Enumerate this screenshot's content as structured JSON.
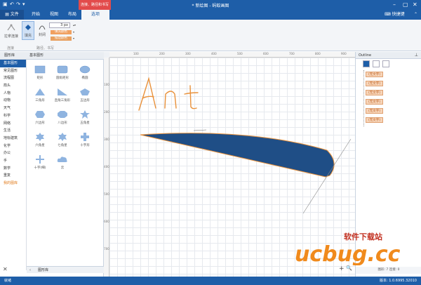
{
  "window": {
    "title": "* 新绘图 - 蚂蚁画图",
    "context_tab_header": "连接、路径和书写",
    "quick_access": [
      "save-icon",
      "undo-icon",
      "redo-icon",
      "dropdown-icon"
    ],
    "controls": [
      "minimize",
      "restore",
      "close"
    ]
  },
  "ribbon_tabs": [
    {
      "label": "文件",
      "icon": "file-icon"
    },
    {
      "label": "开始"
    },
    {
      "label": "视图"
    },
    {
      "label": "布局"
    },
    {
      "label": "选项",
      "active": true
    }
  ],
  "quick_link": "快捷键",
  "ribbon": {
    "buttons": {
      "fill": "填充",
      "close_path": "封闭",
      "close_connection": "拉拿连接"
    },
    "stroke_width": "3 px",
    "color_fill": "填充颜色",
    "color_stroke": "描边颜色",
    "group_labels": [
      "连接",
      "路径、书写"
    ]
  },
  "library": {
    "header": "图形库",
    "subheader": "基本图形",
    "categories": [
      {
        "label": "基本图形",
        "selected": true
      },
      {
        "label": "常见图形"
      },
      {
        "label": "流程图"
      },
      {
        "label": "箭头"
      },
      {
        "label": "人物"
      },
      {
        "label": "动物"
      },
      {
        "label": "天气"
      },
      {
        "label": "科学"
      },
      {
        "label": "网络"
      },
      {
        "label": "生活"
      },
      {
        "label": "地标建筑"
      },
      {
        "label": "化学"
      },
      {
        "label": "办公"
      },
      {
        "label": "手"
      },
      {
        "label": "数学"
      },
      {
        "label": "重复"
      },
      {
        "label": "我的图库",
        "orange": true
      }
    ],
    "shapes": [
      {
        "label": "矩形",
        "icon": "rectangle-icon"
      },
      {
        "label": "圆角矩形",
        "icon": "rounded-rect-icon"
      },
      {
        "label": "椭圆",
        "icon": "ellipse-icon"
      },
      {
        "label": "三角形",
        "icon": "triangle-icon"
      },
      {
        "label": "直角三角形",
        "icon": "right-triangle-icon"
      },
      {
        "label": "五边形",
        "icon": "pentagon-icon"
      },
      {
        "label": "六边形",
        "icon": "hexagon-icon"
      },
      {
        "label": "八边形",
        "icon": "octagon-icon"
      },
      {
        "label": "五角星",
        "icon": "star5-icon"
      },
      {
        "label": "六角星",
        "icon": "star6-icon"
      },
      {
        "label": "七角星",
        "icon": "star7-icon"
      },
      {
        "label": "十字形",
        "icon": "cross-icon"
      },
      {
        "label": "十字(细)",
        "icon": "thin-cross-icon"
      },
      {
        "label": "云",
        "icon": "cloud-icon"
      }
    ],
    "footer": "图形库"
  },
  "canvas": {
    "ruler_h_ticks": [
      "100",
      "200",
      "300",
      "400",
      "500",
      "600",
      "700",
      "800",
      "900"
    ],
    "ruler_v_ticks": [
      "100",
      "200",
      "300",
      "400",
      "500",
      "600",
      "700"
    ],
    "handwriting": "Ant",
    "zoom_in": "+",
    "zoom_search": "🔍"
  },
  "outline": {
    "title": "Outline",
    "items": [
      "(无文字)",
      "(无文字)",
      "(无文字)",
      "(无文字)",
      "(无文字)",
      "(无文字)"
    ],
    "footer": "图形: 7  连接: 0"
  },
  "status": {
    "left": "就绪",
    "right": "版本: 1.0.6995.32010"
  },
  "watermark": {
    "line1": "软件下载站",
    "line2": "ucbug.cc"
  }
}
